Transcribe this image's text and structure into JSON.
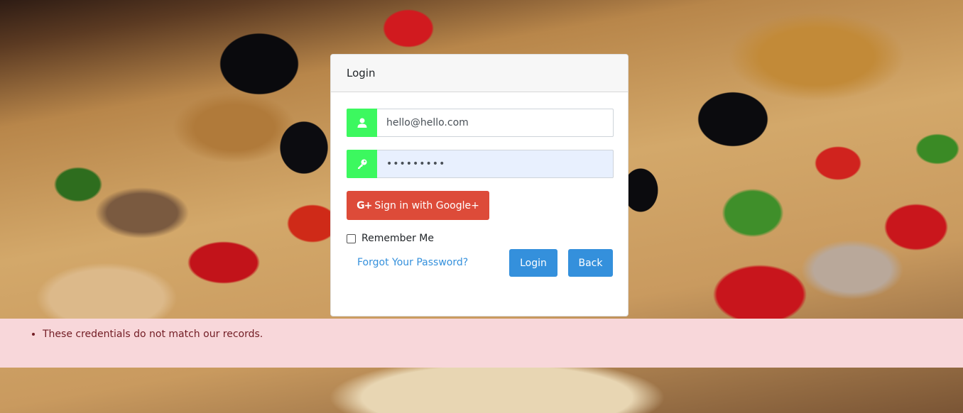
{
  "card": {
    "title": "Login"
  },
  "email": {
    "value": "hello@hello.com",
    "icon": "user-icon"
  },
  "password": {
    "value": "•••••••••",
    "icon": "key-icon"
  },
  "google": {
    "icon_text": "G+",
    "label": "Sign in with Google+"
  },
  "remember": {
    "label": "Remember Me",
    "checked": false
  },
  "forgot": {
    "label": "Forgot Your Password?"
  },
  "buttons": {
    "login": "Login",
    "back": "Back"
  },
  "alert": {
    "errors": [
      "These credentials do not match our records."
    ]
  },
  "colors": {
    "addon": "#3cf85f",
    "google": "#dd4b39",
    "primary": "#3490dc",
    "alert_bg": "#f8d7da",
    "alert_text": "#721c24"
  }
}
